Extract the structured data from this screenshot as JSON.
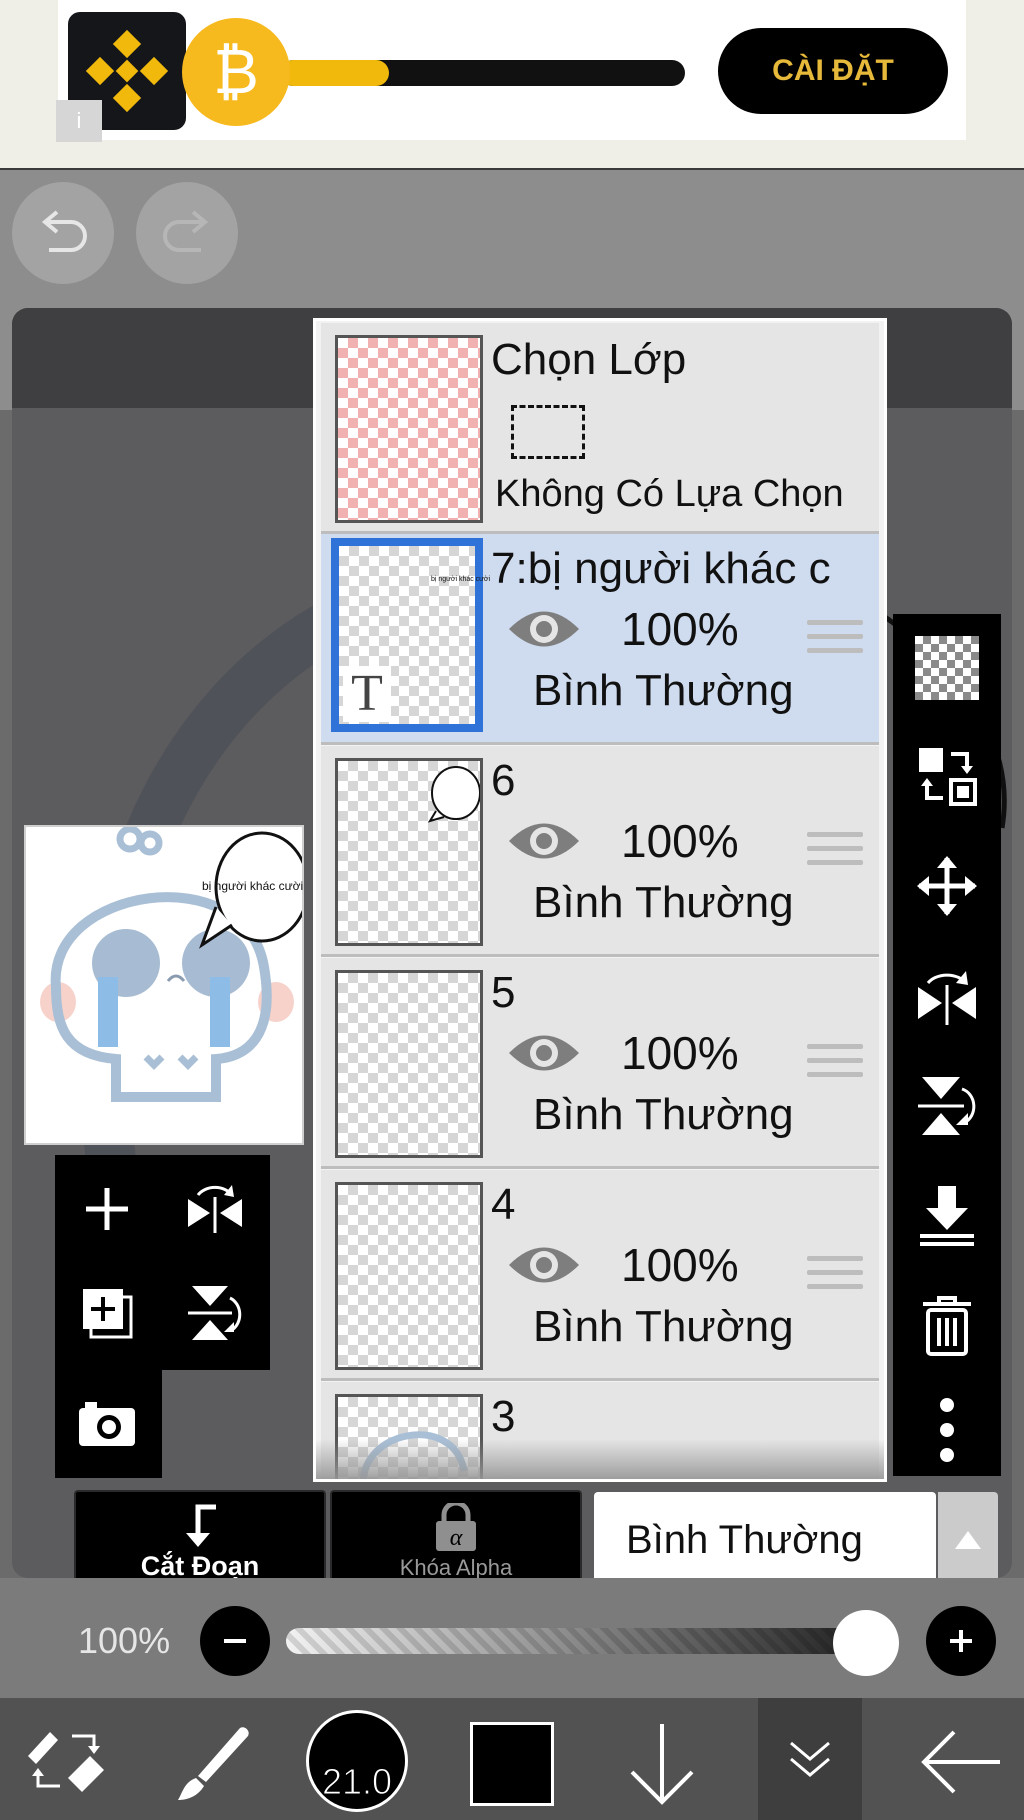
{
  "ad": {
    "install_label": "CÀI ĐẶT",
    "coin_symbol": "₿",
    "progress": 0.27,
    "info_icon": "i"
  },
  "toolbar": {
    "undo_icon": "undo-icon",
    "redo_icon": "redo-icon"
  },
  "preview": {
    "speech_text": "bị người khác cười"
  },
  "layers": {
    "select_layer": {
      "title": "Chọn Lớp",
      "status": "Không Có Lựa Chọn"
    },
    "items": [
      {
        "name": "7:bị người khác c",
        "opacity": "100%",
        "blend": "Bình Thường",
        "selected": true,
        "thumb_text": "bị người khác cười",
        "text_layer_mark": "T"
      },
      {
        "name": "6",
        "opacity": "100%",
        "blend": "Bình Thường",
        "selected": false
      },
      {
        "name": "5",
        "opacity": "100%",
        "blend": "Bình Thường",
        "selected": false
      },
      {
        "name": "4",
        "opacity": "100%",
        "blend": "Bình Thường",
        "selected": false
      },
      {
        "name": "3"
      }
    ]
  },
  "controls": {
    "clipping_label": "Cắt Đoạn",
    "alpha_lock_label": "Khóa Alpha",
    "blend_mode": "Bình Thường",
    "opacity_label": "100%",
    "opacity_value": 1.0
  },
  "bottom_nav": {
    "brush_size": "21.0",
    "color": "#000000"
  },
  "colors": {
    "selected_border": "#2f73d9",
    "selected_row": "#cfdcef",
    "ad_accent": "#f0b90b"
  }
}
